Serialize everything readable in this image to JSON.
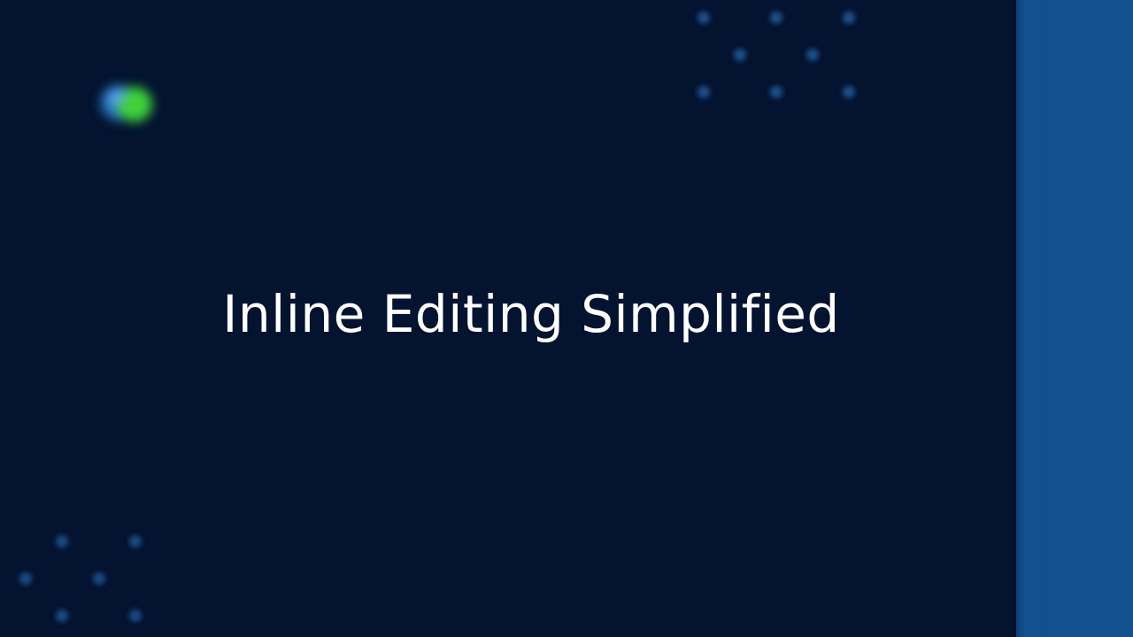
{
  "headline": "Inline Editing Simplified",
  "logo": {
    "icon": "globe-logo-icon",
    "wordmark": ""
  },
  "decorations": {
    "top_right_dots": "dot-pattern-icon",
    "bottom_left_dots": "dot-pattern-icon"
  },
  "colors": {
    "background": "#031330",
    "side_panel": "#15508f",
    "logo_blue": "#2a78c8",
    "logo_green": "#3fd13a",
    "headline_text": "#ffffff",
    "dot_color": "#1d4f8a"
  }
}
